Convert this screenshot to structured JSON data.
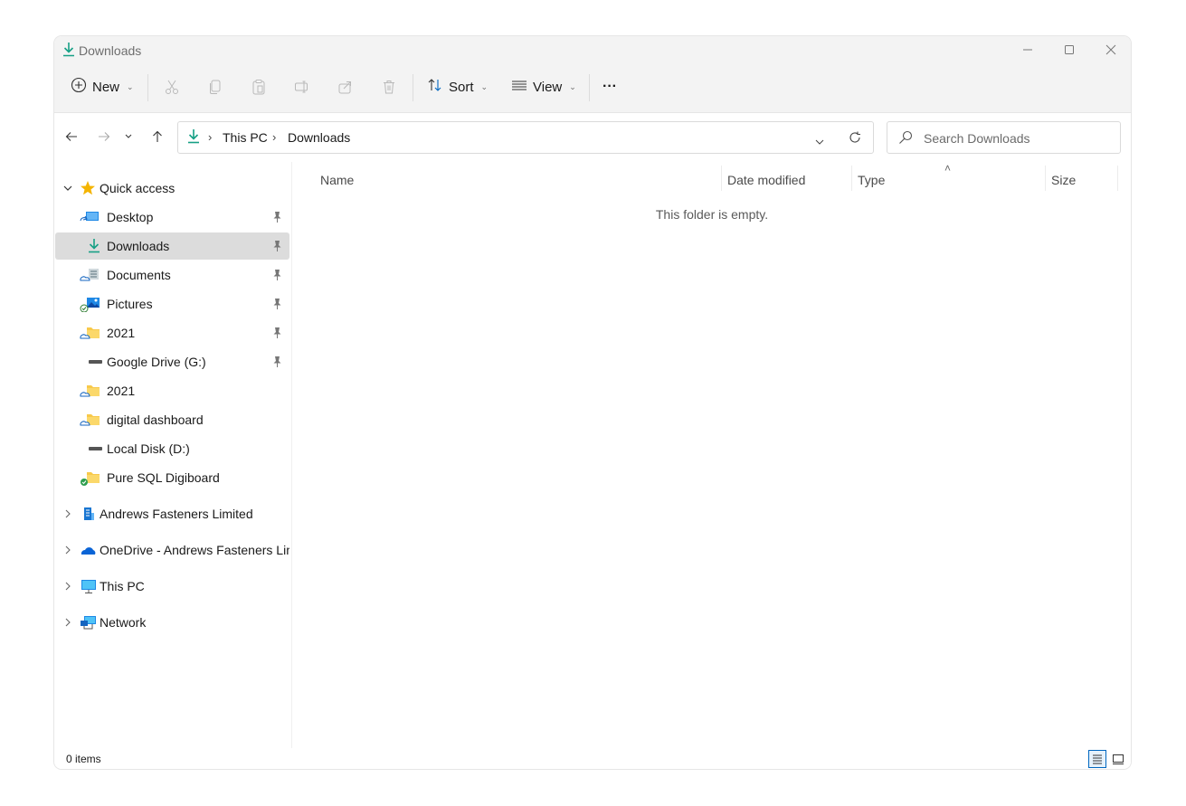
{
  "window": {
    "title": "Downloads"
  },
  "toolbar": {
    "new_label": "New",
    "sort_label": "Sort",
    "view_label": "View",
    "more_label": "···",
    "disabled_actions": [
      "cut-icon",
      "copy-icon",
      "paste-icon",
      "rename-icon",
      "share-icon",
      "delete-icon"
    ]
  },
  "address": {
    "crumbs": [
      "This PC",
      "Downloads"
    ],
    "search_placeholder": "Search Downloads"
  },
  "sidebar": {
    "quick_access_label": "Quick access",
    "quick_items": [
      {
        "label": "Desktop",
        "icon": "desktop-folder-icon",
        "pinned": true
      },
      {
        "label": "Downloads",
        "icon": "download-icon",
        "pinned": true,
        "selected": true
      },
      {
        "label": "Documents",
        "icon": "documents-folder-icon",
        "pinned": true
      },
      {
        "label": "Pictures",
        "icon": "pictures-folder-icon",
        "pinned": true
      },
      {
        "label": "2021",
        "icon": "folder-icon",
        "pinned": true
      },
      {
        "label": "Google Drive (G:)",
        "icon": "drive-icon",
        "pinned": true
      },
      {
        "label": "2021",
        "icon": "folder-icon",
        "pinned": false
      },
      {
        "label": "digital dashboard",
        "icon": "folder-icon",
        "pinned": false
      },
      {
        "label": "Local Disk (D:)",
        "icon": "drive-icon",
        "pinned": false
      },
      {
        "label": "Pure SQL Digiboard",
        "icon": "folder-icon",
        "pinned": false
      }
    ],
    "sections": [
      {
        "label": "Andrews Fasteners Limited",
        "icon": "building-icon"
      },
      {
        "label": "OneDrive - Andrews Fasteners Lim",
        "icon": "onedrive-cloud-icon"
      },
      {
        "label": "This PC",
        "icon": "computer-icon"
      },
      {
        "label": "Network",
        "icon": "network-icon"
      }
    ]
  },
  "columns": {
    "name": "Name",
    "date_modified": "Date modified",
    "type": "Type",
    "size": "Size"
  },
  "content": {
    "empty_message": "This folder is empty."
  },
  "status": {
    "items_count": "0 items"
  },
  "colors": {
    "accent": "#0067c0",
    "download_green": "#16a085",
    "folder_yellow": "#f8c94a",
    "selected_bg": "#dcdcdc"
  }
}
